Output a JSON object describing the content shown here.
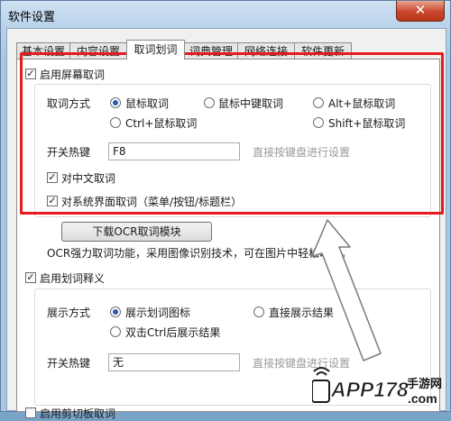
{
  "window": {
    "title": "软件设置",
    "close_glyph": "✕"
  },
  "tabs": [
    {
      "label": "基本设置"
    },
    {
      "label": "内容设置"
    },
    {
      "label": "取词划词"
    },
    {
      "label": "词典管理"
    },
    {
      "label": "网络连接"
    },
    {
      "label": "软件更新"
    }
  ],
  "pick": {
    "enable_label": "启用屏幕取词",
    "enable_checked": true,
    "mode_label": "取词方式",
    "modes": [
      {
        "label": "鼠标取词",
        "selected": true
      },
      {
        "label": "鼠标中键取词",
        "selected": false
      },
      {
        "label": "Alt+鼠标取词",
        "selected": false
      },
      {
        "label": "Ctrl+鼠标取词",
        "selected": false
      },
      {
        "label": "Shift+鼠标取词",
        "selected": false
      }
    ],
    "hotkey_label": "开关热键",
    "hotkey_value": "F8",
    "hotkey_hint": "直接按键盘进行设置",
    "chinese_label": "对中文取词",
    "chinese_checked": true,
    "system_label": "对系统界面取词（菜单/按钮/标题栏）",
    "system_checked": true,
    "ocr_button": "下载OCR取词模块",
    "ocr_desc": "OCR强力取词功能，采用图像识别技术，可在图片中轻松取词。"
  },
  "select": {
    "enable_label": "启用划词释义",
    "enable_checked": true,
    "display_label": "展示方式",
    "displays": [
      {
        "label": "展示划词图标",
        "selected": true
      },
      {
        "label": "直接展示结果",
        "selected": false
      },
      {
        "label": "双击Ctrl后展示结果",
        "selected": false
      }
    ],
    "hotkey_label": "开关热键",
    "hotkey_value": "无",
    "hotkey_hint": "直接按键盘进行设置"
  },
  "clipboard": {
    "enable_label": "启用剪切板取词",
    "enable_checked": false
  },
  "watermark": {
    "text": "APP178",
    "sub": "手游网",
    "domain": ".com"
  },
  "colors": {
    "highlight": "#e8191f",
    "arrow": "#ffffff",
    "watermark": "#1a1a1a"
  }
}
